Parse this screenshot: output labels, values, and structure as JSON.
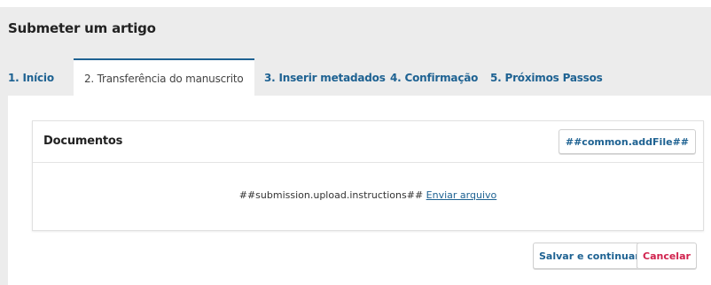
{
  "page": {
    "title": "Submeter um artigo"
  },
  "tabs": [
    {
      "label": "1. Início"
    },
    {
      "label": "2. Transferência do manuscrito"
    },
    {
      "label": "3. Inserir metadados"
    },
    {
      "label": "4. Confirmação"
    },
    {
      "label": "5. Próximos Passos"
    }
  ],
  "active_tab": "2. Transferência do manuscrito",
  "documents": {
    "title": "Documentos",
    "add_file_label": "##common.addFile##",
    "instructions": "##submission.upload.instructions##",
    "upload_link": "Enviar arquivo"
  },
  "actions": {
    "save_label": "Salvar e continuar",
    "cancel_label": "Cancelar"
  },
  "colors": {
    "link": "#1e6292",
    "cancel": "#d0224d",
    "background": "#ececec"
  }
}
